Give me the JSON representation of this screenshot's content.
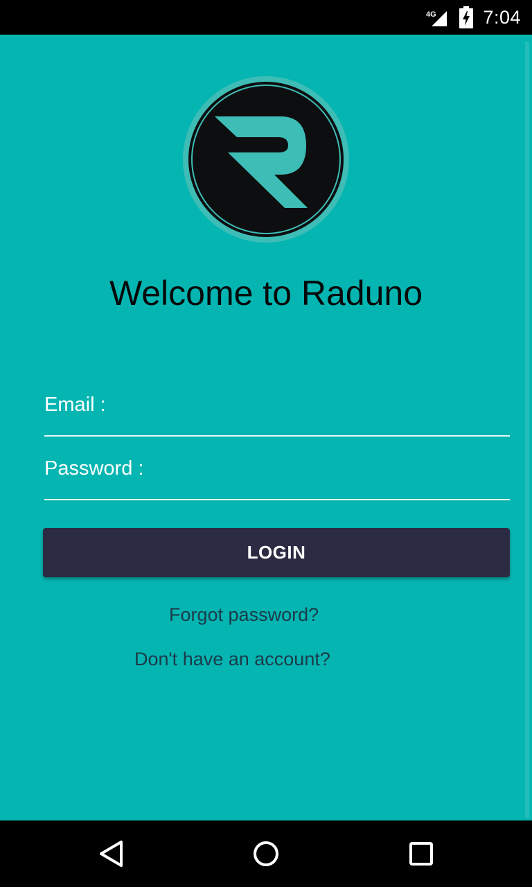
{
  "status_bar": {
    "network_type": "4G",
    "time": "7:04",
    "icons": [
      "signal-icon",
      "battery-charging-icon"
    ]
  },
  "logo": {
    "alt": "R"
  },
  "welcome_title": "Welcome to Raduno",
  "form": {
    "email_label": "Email :",
    "email_value": "",
    "password_label": "Password :",
    "password_value": "",
    "login_label": "LOGIN"
  },
  "links": {
    "forgot_password": "Forgot password?",
    "no_account": "Don't have an account?"
  },
  "nav_bar": {
    "icons": [
      "back-icon",
      "home-icon",
      "recents-icon"
    ]
  },
  "colors": {
    "background": "#05b5b1",
    "button": "#2b2b43",
    "logo_accent": "#3dbdb6",
    "logo_dark": "#0d0e10",
    "link_text": "#1b3b4a"
  }
}
